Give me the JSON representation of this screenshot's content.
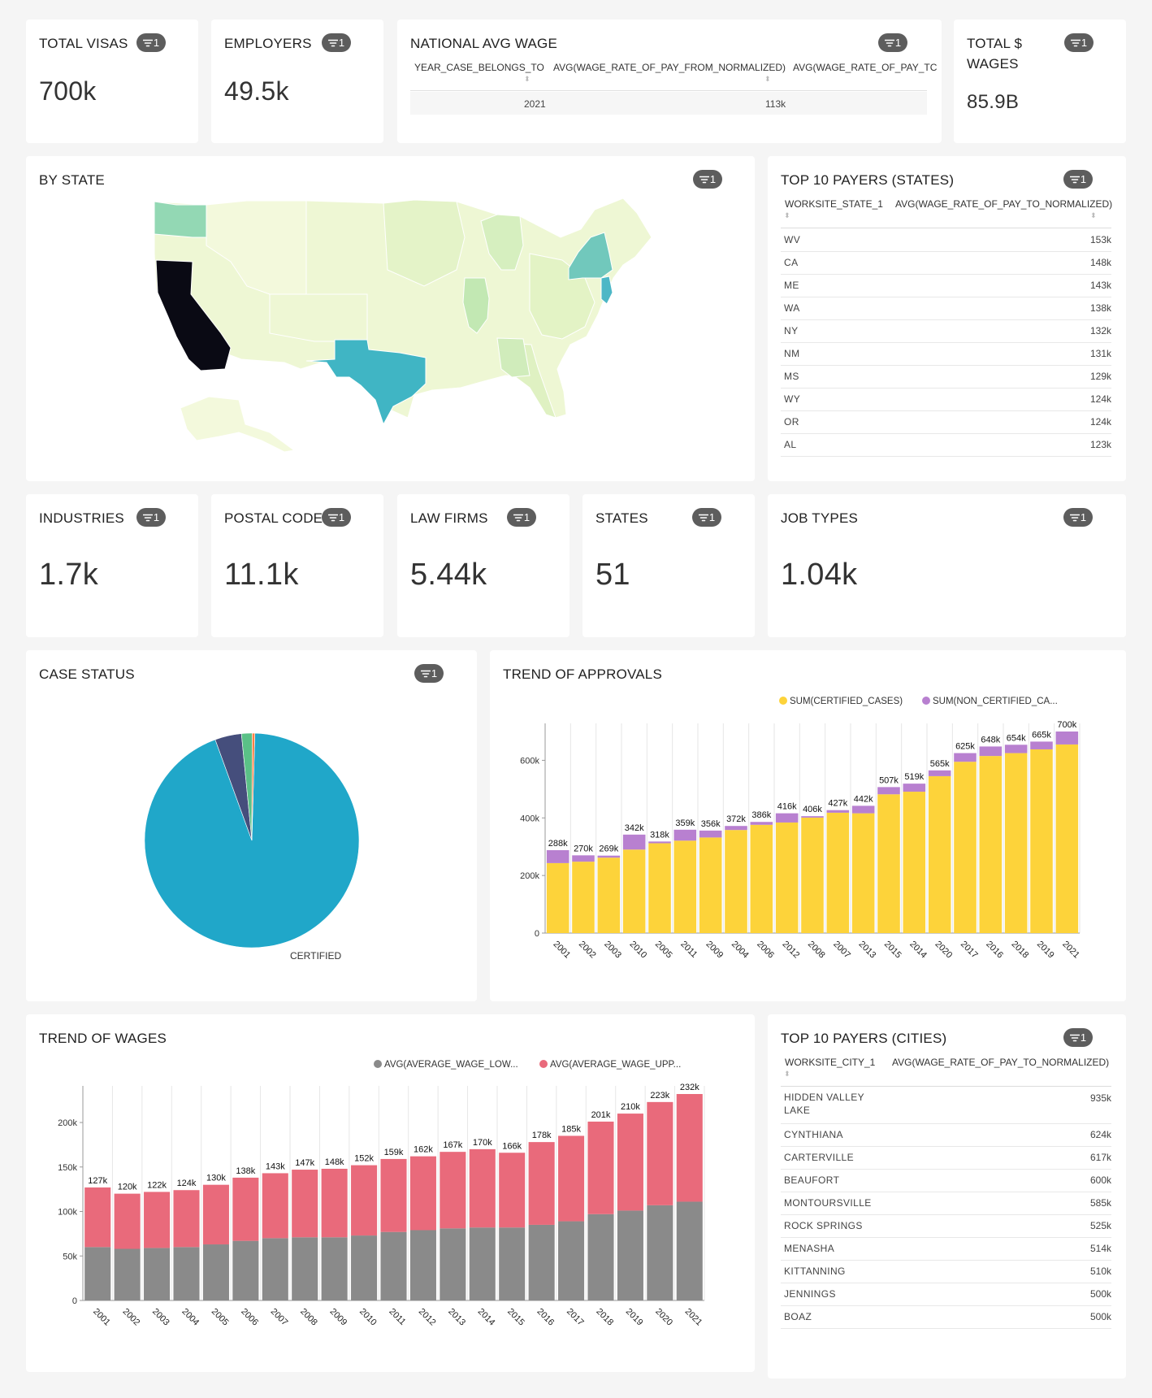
{
  "cards": {
    "total_visas": {
      "title": "TOTAL VISAS",
      "value": "700k",
      "filter_count": "1"
    },
    "employers": {
      "title": "EMPLOYERS",
      "value": "49.5k",
      "filter_count": "1"
    },
    "national_avg_wage": {
      "title": "NATIONAL AVG WAGE",
      "filter_count": "1",
      "columns": [
        "YEAR_CASE_BELONGS_TO",
        "AVG(WAGE_RATE_OF_PAY_FROM_NORMALIZED)",
        "AVG(WAGE_RATE_OF_PAY_TC"
      ],
      "row": [
        "2021",
        "113k"
      ]
    },
    "total_wages": {
      "title_line1": "TOTAL $",
      "title_line2": "WAGES",
      "value": "85.9B",
      "filter_count": "1"
    },
    "by_state": {
      "title": "BY STATE",
      "filter_count": "1"
    },
    "top_states": {
      "title": "TOP 10 PAYERS (STATES)",
      "filter_count": "1",
      "columns": [
        "WORKSITE_STATE_1",
        "AVG(WAGE_RATE_OF_PAY_TO_NORMALIZED)"
      ],
      "rows": [
        [
          "WV",
          "153k"
        ],
        [
          "CA",
          "148k"
        ],
        [
          "ME",
          "143k"
        ],
        [
          "WA",
          "138k"
        ],
        [
          "NY",
          "132k"
        ],
        [
          "NM",
          "131k"
        ],
        [
          "MS",
          "129k"
        ],
        [
          "WY",
          "124k"
        ],
        [
          "OR",
          "124k"
        ],
        [
          "AL",
          "123k"
        ]
      ]
    },
    "industries": {
      "title": "INDUSTRIES",
      "value": "1.7k",
      "filter_count": "1"
    },
    "postal_code": {
      "title": "POSTAL CODE",
      "value": "11.1k",
      "filter_count": "1"
    },
    "law_firms": {
      "title": "LAW FIRMS",
      "value": "5.44k",
      "filter_count": "1"
    },
    "states": {
      "title": "STATES",
      "value": "51",
      "filter_count": "1"
    },
    "job_types": {
      "title": "JOB TYPES",
      "value": "1.04k",
      "filter_count": "1"
    },
    "case_status": {
      "title": "CASE STATUS",
      "filter_count": "1",
      "slice_label": "CERTIFIED"
    },
    "trend_approvals": {
      "title": "TREND OF APPROVALS"
    },
    "trend_wages": {
      "title": "TREND OF WAGES"
    },
    "top_cities": {
      "title": "TOP 10 PAYERS (CITIES)",
      "filter_count": "1",
      "columns": [
        "WORKSITE_CITY_1",
        "AVG(WAGE_RATE_OF_PAY_TO_NORMALIZED)"
      ],
      "rows": [
        [
          "HIDDEN VALLEY LAKE",
          "935k"
        ],
        [
          "CYNTHIANA",
          "624k"
        ],
        [
          "CARTERVILLE",
          "617k"
        ],
        [
          "BEAUFORT",
          "600k"
        ],
        [
          "MONTOURSVILLE",
          "585k"
        ],
        [
          "ROCK SPRINGS",
          "525k"
        ],
        [
          "MENASHA",
          "514k"
        ],
        [
          "KITTANNING",
          "510k"
        ],
        [
          "JENNINGS",
          "500k"
        ],
        [
          "BOAZ",
          "500k"
        ]
      ]
    }
  },
  "colors": {
    "certified": "#fdd33a",
    "non_certified": "#b880d0",
    "wage_low": "#8a8a8a",
    "wage_upper": "#e96a7b",
    "pie_certified": "#20a7c9",
    "pie_2": "#454e7c",
    "pie_3": "#5ac187",
    "pie_4": "#ff7f44",
    "badge": "#5d5d5d"
  },
  "chart_data": [
    {
      "type": "pie",
      "title": "CASE STATUS",
      "labels": [
        "CERTIFIED",
        "",
        "",
        ""
      ],
      "values": [
        94.0,
        4.0,
        1.6,
        0.4
      ]
    },
    {
      "type": "bar",
      "stacked": true,
      "title": "TREND OF APPROVALS",
      "categories": [
        "2001",
        "2002",
        "2003",
        "2010",
        "2005",
        "2011",
        "2009",
        "2004",
        "2006",
        "2012",
        "2008",
        "2007",
        "2013",
        "2015",
        "2014",
        "2020",
        "2017",
        "2016",
        "2018",
        "2019",
        "2021"
      ],
      "series": [
        {
          "name": "SUM(CERTIFIED_CASES)",
          "values": [
            243000,
            248000,
            262000,
            290000,
            312000,
            321000,
            332000,
            358000,
            376000,
            384000,
            401000,
            418000,
            416000,
            482000,
            491000,
            545000,
            595000,
            615000,
            625000,
            638000,
            655000
          ]
        },
        {
          "name": "SUM(NON_CERTIFIED_CA...",
          "values": [
            45000,
            22000,
            7000,
            52000,
            6000,
            38000,
            24000,
            14000,
            10000,
            32000,
            5000,
            9000,
            26000,
            25000,
            28000,
            20000,
            30000,
            33000,
            29000,
            27000,
            45000
          ]
        }
      ],
      "totals_labels": [
        "288k",
        "270k",
        "269k",
        "342k",
        "318k",
        "359k",
        "356k",
        "372k",
        "386k",
        "416k",
        "406k",
        "427k",
        "442k",
        "507k",
        "519k",
        "565k",
        "625k",
        "648k",
        "654k",
        "665k",
        "700k"
      ],
      "ylim": [
        0,
        700000
      ],
      "yticks": [
        0,
        200000,
        400000,
        600000
      ],
      "ytick_labels": [
        "0",
        "200k",
        "400k",
        "600k"
      ],
      "grid": true,
      "legend": "top-right"
    },
    {
      "type": "bar",
      "stacked": true,
      "title": "TREND OF WAGES",
      "categories": [
        "2001",
        "2002",
        "2003",
        "2004",
        "2005",
        "2006",
        "2007",
        "2008",
        "2009",
        "2010",
        "2011",
        "2012",
        "2013",
        "2014",
        "2015",
        "2016",
        "2017",
        "2018",
        "2019",
        "2020",
        "2021"
      ],
      "series": [
        {
          "name": "AVG(AVERAGE_WAGE_LOW...",
          "values": [
            60000,
            58000,
            59000,
            60000,
            63000,
            67000,
            70000,
            71000,
            71000,
            73000,
            77000,
            79000,
            81000,
            82000,
            82000,
            85000,
            89000,
            97000,
            101000,
            107000,
            111000
          ]
        },
        {
          "name": "AVG(AVERAGE_WAGE_UPP...",
          "values": [
            67000,
            62000,
            63000,
            64000,
            67000,
            71000,
            73000,
            76000,
            77000,
            79000,
            82000,
            83000,
            86000,
            88000,
            84000,
            93000,
            96000,
            104000,
            109000,
            116000,
            121000
          ]
        }
      ],
      "totals_labels": [
        "127k",
        "120k",
        "122k",
        "124k",
        "130k",
        "138k",
        "143k",
        "147k",
        "148k",
        "152k",
        "159k",
        "162k",
        "167k",
        "170k",
        "166k",
        "178k",
        "185k",
        "201k",
        "210k",
        "223k",
        "232k"
      ],
      "ylim": [
        0,
        232000
      ],
      "yticks": [
        0,
        50000,
        100000,
        150000,
        200000
      ],
      "ytick_labels": [
        "0",
        "50k",
        "100k",
        "150k",
        "200k"
      ],
      "grid": true,
      "legend": "top-right"
    }
  ]
}
